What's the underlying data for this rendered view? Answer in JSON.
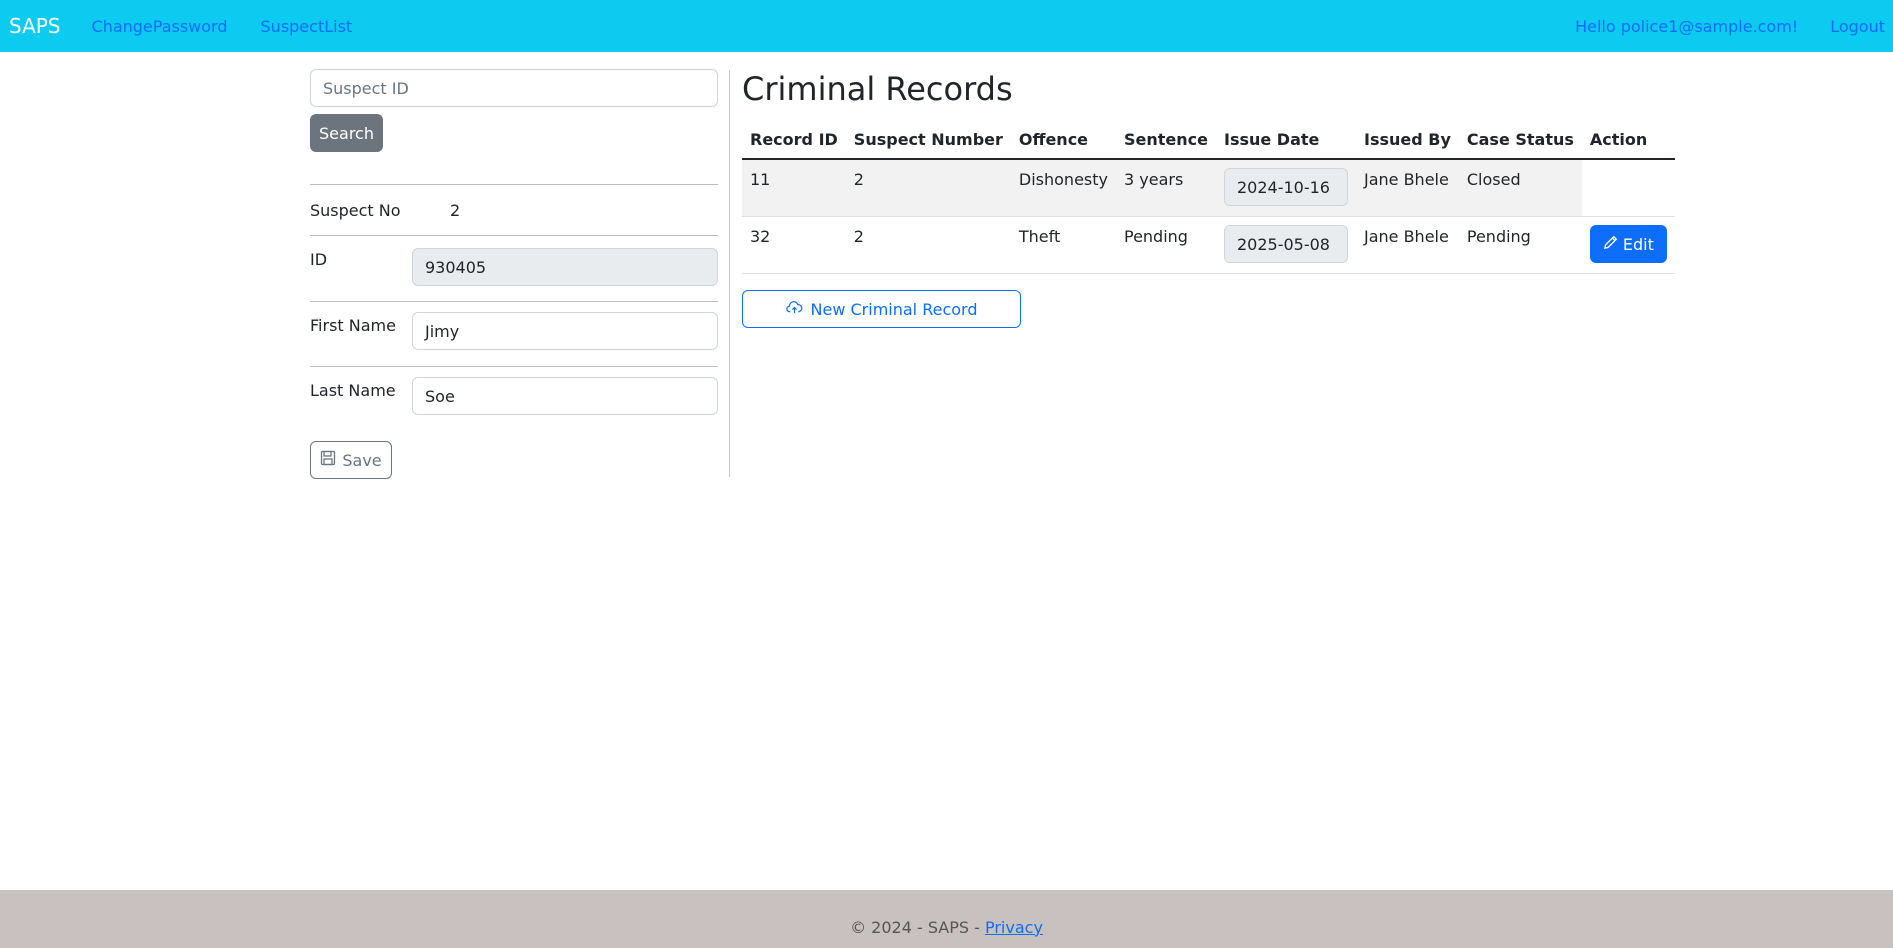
{
  "nav": {
    "brand": "SAPS",
    "links": [
      "ChangePassword",
      "SuspectList"
    ],
    "greeting": "Hello police1@sample.com!",
    "logout": "Logout",
    "bg_color": "#0dcaf0",
    "link_color": "#0d6efd"
  },
  "search": {
    "placeholder": "Suspect ID",
    "button": "Search"
  },
  "suspect": {
    "no_label": "Suspect No",
    "no_value": "2",
    "id_label": "ID",
    "id_value": "930405",
    "first_name_label": "First Name",
    "first_name_value": "Jimy",
    "last_name_label": "Last Name",
    "last_name_value": "Soe",
    "save_button": "Save"
  },
  "records": {
    "title": "Criminal Records",
    "columns": [
      "Record ID",
      "Suspect Number",
      "Offence",
      "Sentence",
      "Issue Date",
      "Issued By",
      "Case Status",
      "Action"
    ],
    "rows": [
      {
        "record_id": "11",
        "suspect_number": "2",
        "offence": "Dishonesty",
        "sentence": "3 years",
        "issue_date": "2024-10-16",
        "issued_by": "Jane Bhele",
        "case_status": "Closed",
        "action": ""
      },
      {
        "record_id": "32",
        "suspect_number": "2",
        "offence": "Theft",
        "sentence": "Pending",
        "issue_date": "2025-05-08",
        "issued_by": "Jane Bhele",
        "case_status": "Pending",
        "action": "Edit"
      }
    ],
    "new_button": "New Criminal Record"
  },
  "footer": {
    "text": "© 2024 - SAPS - ",
    "privacy": "Privacy"
  },
  "icons": {
    "save": "floppy-disk-icon",
    "edit": "pencil-icon",
    "new": "cloud-upload-icon"
  }
}
